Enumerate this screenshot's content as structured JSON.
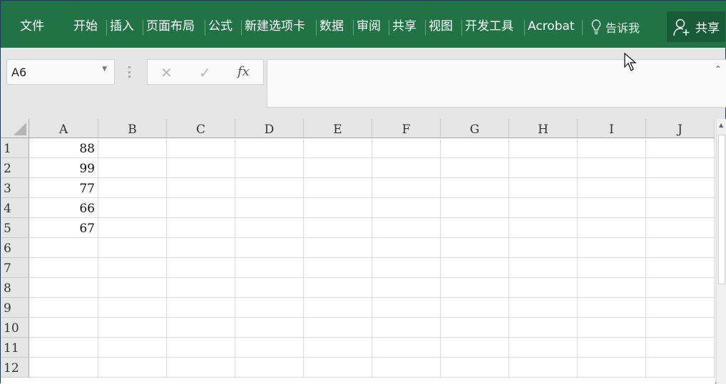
{
  "ribbon": {
    "tabs": [
      "文件",
      "开始",
      "插入",
      "页面布局",
      "公式",
      "新建选项卡",
      "数据",
      "审阅",
      "共享",
      "视图",
      "开发工具",
      "Acrobat"
    ],
    "tell_me": "告诉我",
    "share": "共享",
    "accent": "#217346"
  },
  "formula_bar": {
    "name_box": "A6",
    "cancel": "✕",
    "enter": "✓",
    "fx": "fx",
    "value": ""
  },
  "sheet": {
    "columns": [
      "A",
      "B",
      "C",
      "D",
      "E",
      "F",
      "G",
      "H",
      "I",
      "J"
    ],
    "rows": [
      "1",
      "2",
      "3",
      "4",
      "5",
      "6",
      "7",
      "8",
      "9",
      "10",
      "11",
      "12"
    ],
    "cells_A": [
      "88",
      "99",
      "77",
      "66",
      "67"
    ]
  }
}
